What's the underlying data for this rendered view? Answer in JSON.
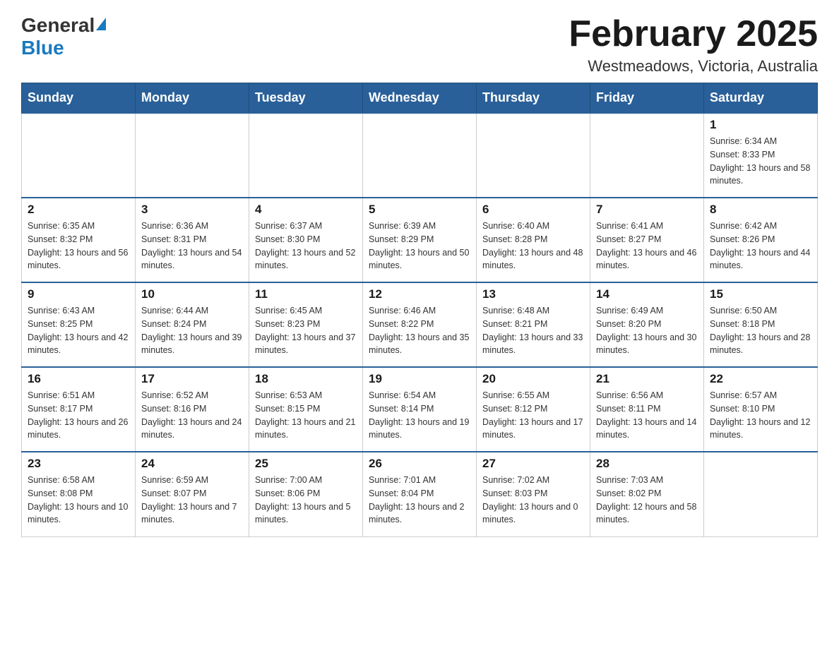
{
  "logo": {
    "general": "General",
    "blue": "Blue"
  },
  "title": "February 2025",
  "location": "Westmeadows, Victoria, Australia",
  "weekdays": [
    "Sunday",
    "Monday",
    "Tuesday",
    "Wednesday",
    "Thursday",
    "Friday",
    "Saturday"
  ],
  "weeks": [
    [
      {
        "day": "",
        "info": ""
      },
      {
        "day": "",
        "info": ""
      },
      {
        "day": "",
        "info": ""
      },
      {
        "day": "",
        "info": ""
      },
      {
        "day": "",
        "info": ""
      },
      {
        "day": "",
        "info": ""
      },
      {
        "day": "1",
        "info": "Sunrise: 6:34 AM\nSunset: 8:33 PM\nDaylight: 13 hours and 58 minutes."
      }
    ],
    [
      {
        "day": "2",
        "info": "Sunrise: 6:35 AM\nSunset: 8:32 PM\nDaylight: 13 hours and 56 minutes."
      },
      {
        "day": "3",
        "info": "Sunrise: 6:36 AM\nSunset: 8:31 PM\nDaylight: 13 hours and 54 minutes."
      },
      {
        "day": "4",
        "info": "Sunrise: 6:37 AM\nSunset: 8:30 PM\nDaylight: 13 hours and 52 minutes."
      },
      {
        "day": "5",
        "info": "Sunrise: 6:39 AM\nSunset: 8:29 PM\nDaylight: 13 hours and 50 minutes."
      },
      {
        "day": "6",
        "info": "Sunrise: 6:40 AM\nSunset: 8:28 PM\nDaylight: 13 hours and 48 minutes."
      },
      {
        "day": "7",
        "info": "Sunrise: 6:41 AM\nSunset: 8:27 PM\nDaylight: 13 hours and 46 minutes."
      },
      {
        "day": "8",
        "info": "Sunrise: 6:42 AM\nSunset: 8:26 PM\nDaylight: 13 hours and 44 minutes."
      }
    ],
    [
      {
        "day": "9",
        "info": "Sunrise: 6:43 AM\nSunset: 8:25 PM\nDaylight: 13 hours and 42 minutes."
      },
      {
        "day": "10",
        "info": "Sunrise: 6:44 AM\nSunset: 8:24 PM\nDaylight: 13 hours and 39 minutes."
      },
      {
        "day": "11",
        "info": "Sunrise: 6:45 AM\nSunset: 8:23 PM\nDaylight: 13 hours and 37 minutes."
      },
      {
        "day": "12",
        "info": "Sunrise: 6:46 AM\nSunset: 8:22 PM\nDaylight: 13 hours and 35 minutes."
      },
      {
        "day": "13",
        "info": "Sunrise: 6:48 AM\nSunset: 8:21 PM\nDaylight: 13 hours and 33 minutes."
      },
      {
        "day": "14",
        "info": "Sunrise: 6:49 AM\nSunset: 8:20 PM\nDaylight: 13 hours and 30 minutes."
      },
      {
        "day": "15",
        "info": "Sunrise: 6:50 AM\nSunset: 8:18 PM\nDaylight: 13 hours and 28 minutes."
      }
    ],
    [
      {
        "day": "16",
        "info": "Sunrise: 6:51 AM\nSunset: 8:17 PM\nDaylight: 13 hours and 26 minutes."
      },
      {
        "day": "17",
        "info": "Sunrise: 6:52 AM\nSunset: 8:16 PM\nDaylight: 13 hours and 24 minutes."
      },
      {
        "day": "18",
        "info": "Sunrise: 6:53 AM\nSunset: 8:15 PM\nDaylight: 13 hours and 21 minutes."
      },
      {
        "day": "19",
        "info": "Sunrise: 6:54 AM\nSunset: 8:14 PM\nDaylight: 13 hours and 19 minutes."
      },
      {
        "day": "20",
        "info": "Sunrise: 6:55 AM\nSunset: 8:12 PM\nDaylight: 13 hours and 17 minutes."
      },
      {
        "day": "21",
        "info": "Sunrise: 6:56 AM\nSunset: 8:11 PM\nDaylight: 13 hours and 14 minutes."
      },
      {
        "day": "22",
        "info": "Sunrise: 6:57 AM\nSunset: 8:10 PM\nDaylight: 13 hours and 12 minutes."
      }
    ],
    [
      {
        "day": "23",
        "info": "Sunrise: 6:58 AM\nSunset: 8:08 PM\nDaylight: 13 hours and 10 minutes."
      },
      {
        "day": "24",
        "info": "Sunrise: 6:59 AM\nSunset: 8:07 PM\nDaylight: 13 hours and 7 minutes."
      },
      {
        "day": "25",
        "info": "Sunrise: 7:00 AM\nSunset: 8:06 PM\nDaylight: 13 hours and 5 minutes."
      },
      {
        "day": "26",
        "info": "Sunrise: 7:01 AM\nSunset: 8:04 PM\nDaylight: 13 hours and 2 minutes."
      },
      {
        "day": "27",
        "info": "Sunrise: 7:02 AM\nSunset: 8:03 PM\nDaylight: 13 hours and 0 minutes."
      },
      {
        "day": "28",
        "info": "Sunrise: 7:03 AM\nSunset: 8:02 PM\nDaylight: 12 hours and 58 minutes."
      },
      {
        "day": "",
        "info": ""
      }
    ]
  ]
}
